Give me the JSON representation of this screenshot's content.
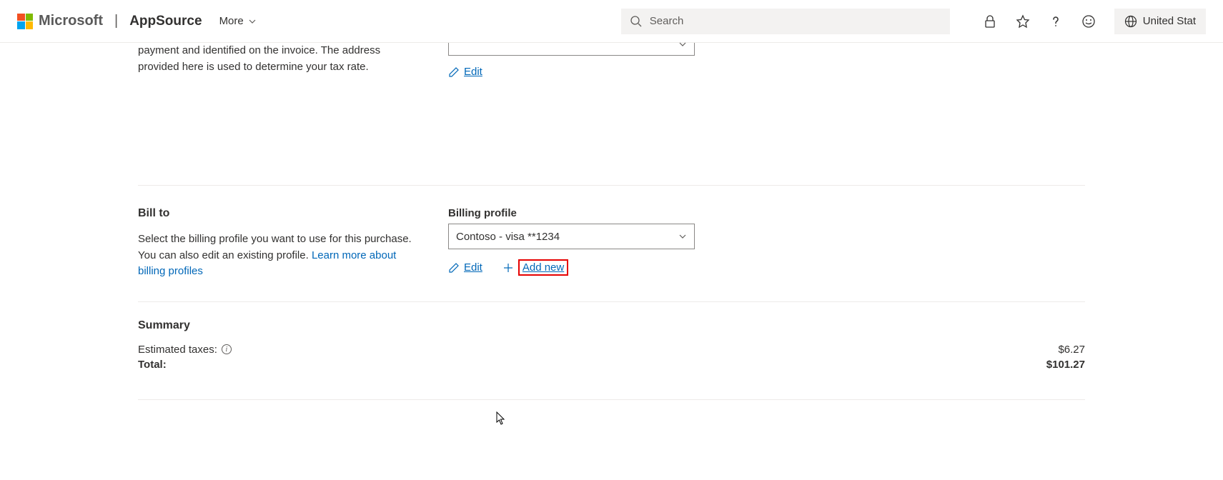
{
  "header": {
    "brand": "Microsoft",
    "product": "AppSource",
    "more": "More",
    "search_placeholder": "Search",
    "region": "United Stat"
  },
  "sold_to": {
    "desc_partial": "payment and identified on the invoice. The address provided here is used to determine your tax rate.",
    "edit": "Edit"
  },
  "bill_to": {
    "title": "Bill to",
    "desc_prefix": "Select the billing profile you want to use for this purchase. You can also edit an existing profile. ",
    "learn_link": "Learn more about billing profiles",
    "field_label": "Billing profile",
    "selected": "Contoso - visa **1234",
    "edit": "Edit",
    "add_new": "Add new"
  },
  "summary": {
    "title": "Summary",
    "taxes_label": "Estimated taxes:",
    "taxes_value": "$6.27",
    "total_label": "Total:",
    "total_value": "$101.27"
  }
}
